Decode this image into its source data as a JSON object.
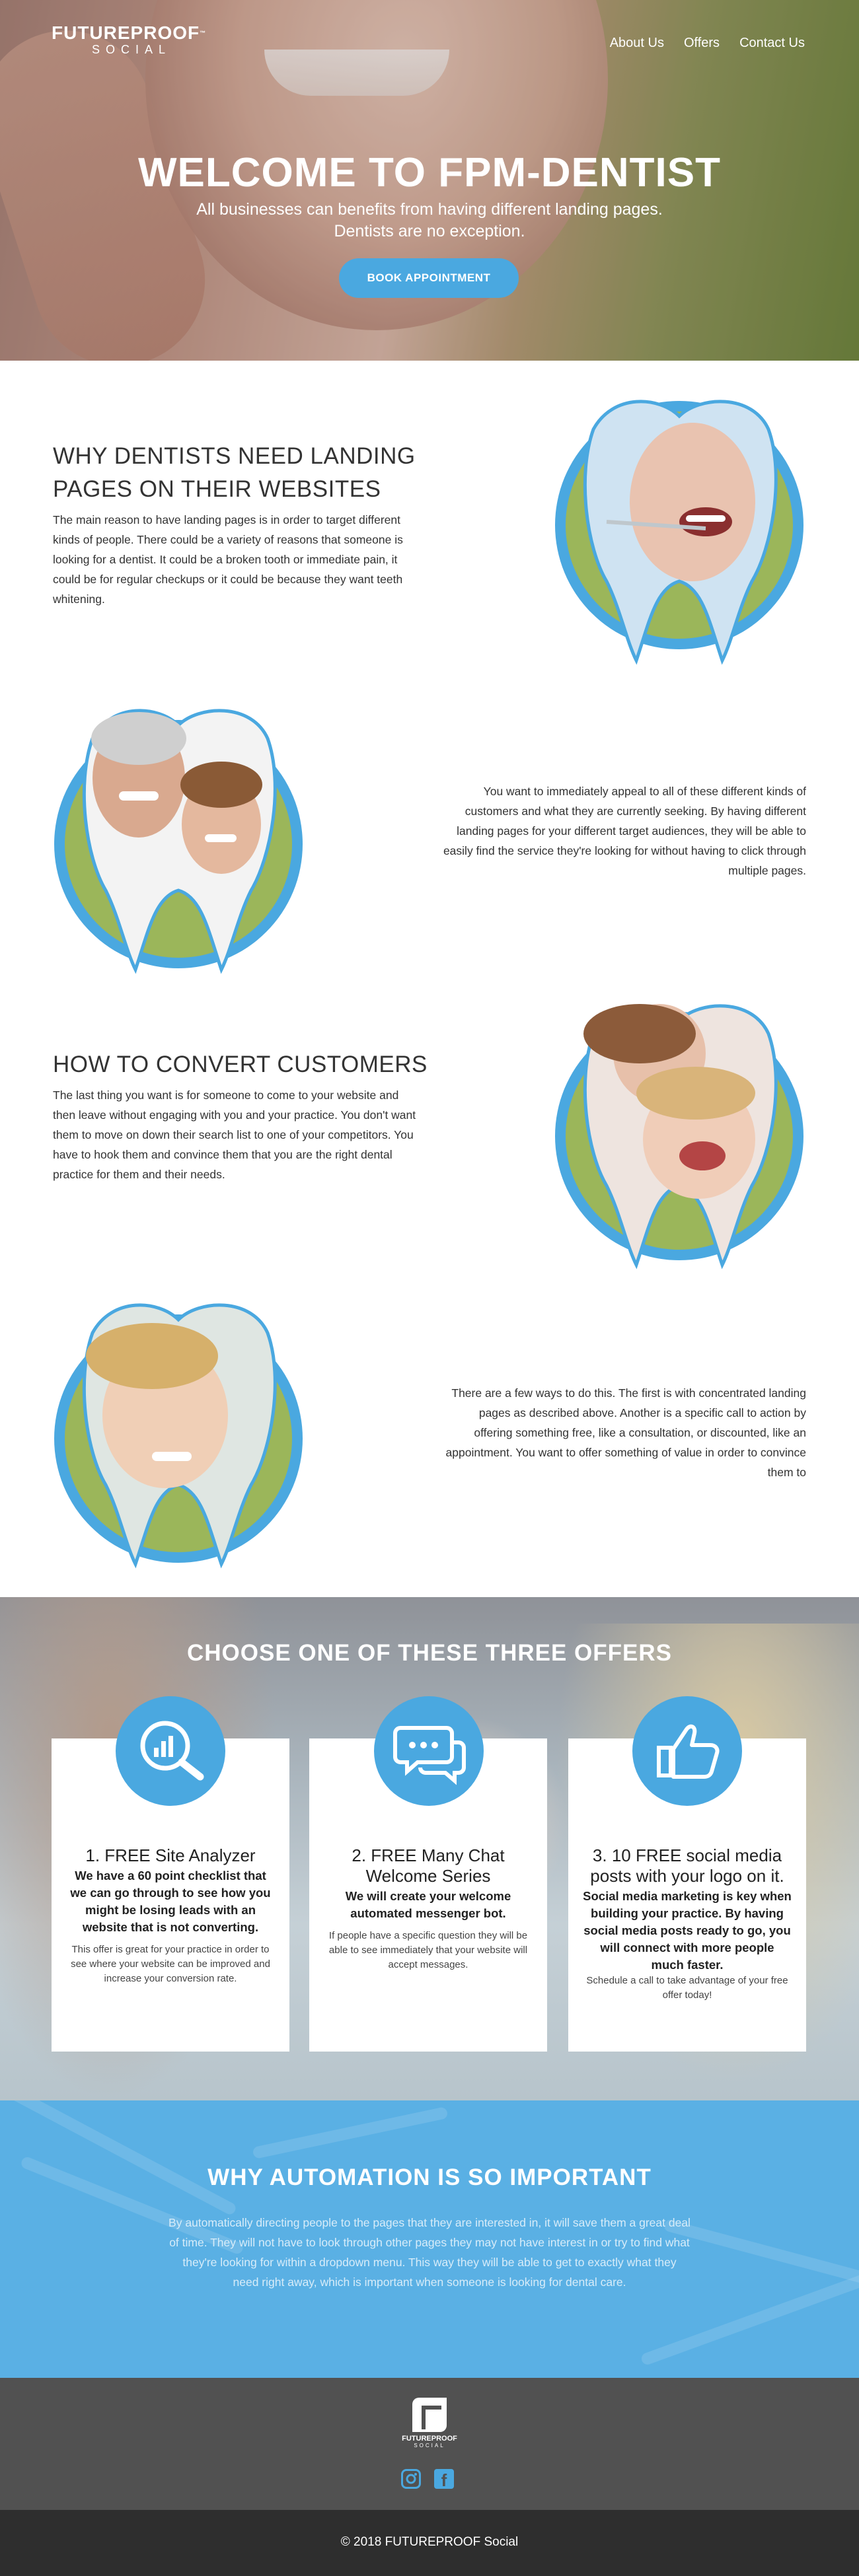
{
  "brand": {
    "logo_line1": "FUTUREPROOF",
    "logo_line2": "SOCIAL",
    "trademark": "™"
  },
  "nav": {
    "items": [
      {
        "label": "About Us"
      },
      {
        "label": "Offers"
      },
      {
        "label": "Contact Us"
      }
    ]
  },
  "hero": {
    "title_prefix": "WELCOME TO ",
    "title_bold": "FPM-DENTIST",
    "subtitle_line1": "All businesses can benefits from having different landing pages.",
    "subtitle_line2": "Dentists are no exception.",
    "cta_label": "BOOK APPOINTMENT"
  },
  "sections": {
    "why": {
      "title_line1": "WHY DENTISTS NEED LANDING",
      "title_line2": "PAGES ON THEIR WEBSITES",
      "body": "The main reason to have landing pages is in order to target different kinds of people. There could be a variety of reasons that someone is looking for a dentist. It could be a broken tooth or immediate pain, it could be for regular checkups or it could be because they want teeth whitening."
    },
    "appeal": {
      "body": "You want to immediately appeal to all of these different kinds of customers and what they are currently seeking. By having different landing pages for your different target audiences, they will be able to easily find the service they're looking for without having to click through multiple pages."
    },
    "convert": {
      "title": "HOW TO CONVERT CUSTOMERS",
      "body": "The last thing you want is for someone to come to your website and then leave without engaging with you and your practice. You don't want them to move on down their search list to one of your competitors. You  have to hook them and convince them that you are the right dental practice for them and their needs."
    },
    "ways": {
      "body": "There are a few ways to do this. The first is with concentrated landing pages as described above. Another is a specific call to action by offering something free, like a consultation, or discounted, like an appointment. You want to offer something of value in order to convince them to"
    }
  },
  "offers": {
    "title": "CHOOSE ONE OF THESE THREE OFFERS",
    "cards": [
      {
        "icon": "analytics-magnifier-icon",
        "title": "1. FREE Site Analyzer",
        "bold": "We have a 60 point checklist that we can go through to see how you might be losing leads with an website that is not converting.",
        "small": "This offer is great for your practice in order to see where your website can be improved and increase your conversion rate."
      },
      {
        "icon": "chat-bubbles-icon",
        "title": "2. FREE Many Chat Welcome Series",
        "bold": "We will create your welcome automated messenger bot.",
        "small": "If people have a specific question they will be able to see immediately that your website will accept messages."
      },
      {
        "icon": "thumbs-up-icon",
        "title": "3. 10 FREE social media posts with your logo on it.",
        "bold": "Social media marketing is key when building your practice. By having social media posts ready to go, you will connect with more people much faster.",
        "small": "Schedule a call to take advantage of your free offer today!"
      }
    ]
  },
  "automation": {
    "title": "WHY AUTOMATION IS SO IMPORTANT",
    "body": "By automatically directing people to the pages that they are interested in, it will save them a great deal of time. They will not have to look through other pages they may not have interest in or try to find what they're looking for within a dropdown menu. This way they will be able to get to exactly what they need right away, which is important when someone is looking for dental care."
  },
  "footer": {
    "logo_line1": "FUTUREPROOF",
    "logo_line2": "SOCIAL",
    "social": [
      "instagram-icon",
      "facebook-icon"
    ],
    "copyright": "© 2018 FUTUREPROOF Social"
  },
  "colors": {
    "accent": "#4aa8e0",
    "footer": "#515151",
    "copy_bar": "#2e2e2e",
    "automation_bg": "#5ab0e4"
  }
}
